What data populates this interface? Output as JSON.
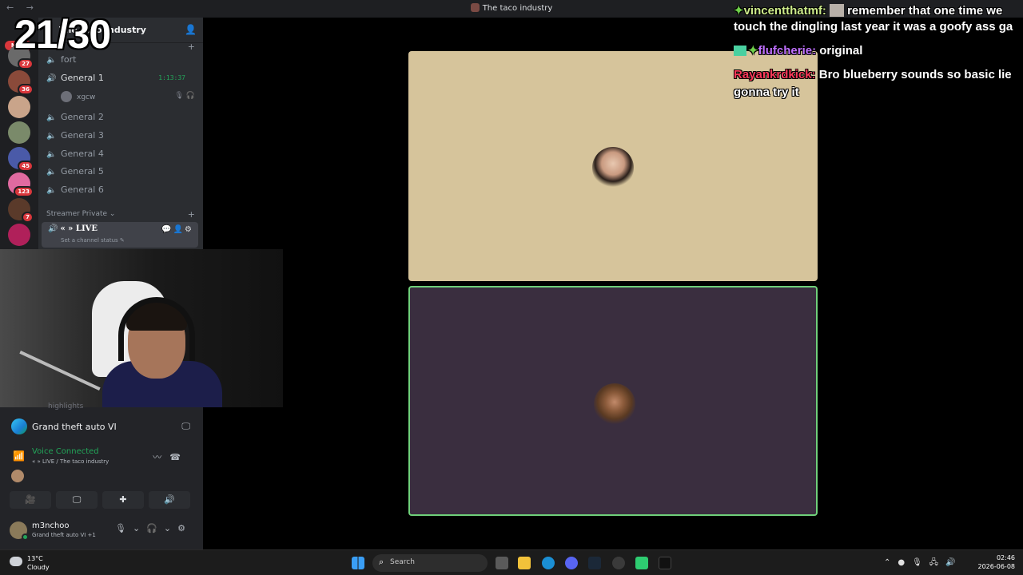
{
  "overlay": {
    "counter": "21/30"
  },
  "titlebar": {
    "title": "The taco industry",
    "nav": "← →"
  },
  "rail": {
    "new_label": "NEW",
    "servers": [
      {
        "badge": "27",
        "color": "#6a6a6a"
      },
      {
        "badge": "36",
        "color": "#8a4a3a"
      },
      {
        "badge": "",
        "color": "#c9a48a"
      },
      {
        "badge": "",
        "color": "#7a8a6a"
      },
      {
        "badge": "45",
        "color": "#4a5aa8"
      },
      {
        "badge": "123",
        "color": "#e06aa0"
      },
      {
        "badge": "7",
        "color": "#5a3a2a"
      },
      {
        "badge": "",
        "color": "#b0205a"
      }
    ]
  },
  "channels": {
    "server_name": "The taco industry",
    "items": [
      {
        "label": "fort"
      },
      {
        "label": "General 1",
        "timer": "1:13:37"
      },
      {
        "label": "General 2"
      },
      {
        "label": "General 3"
      },
      {
        "label": "General 4"
      },
      {
        "label": "General 5"
      },
      {
        "label": "General 6"
      }
    ],
    "member": "xgcw",
    "category": "Streamer Private",
    "live_channel": "« » LIVE",
    "live_status": "Set a channel status"
  },
  "lower": {
    "highlights": "highlights",
    "activity": "Grand theft auto VI",
    "voice_title": "Voice Connected",
    "voice_sub": "« » LIVE / The taco industry",
    "user_name": "m3nchoo",
    "user_status": "Grand theft auto VI +1"
  },
  "chat": [
    {
      "name": "vincentthatmf:",
      "text": "remember that one time we"
    },
    {
      "text": "touch the dingling last year it was a goofy ass ga"
    },
    {
      "name": "flufcherie:",
      "text": "original"
    },
    {
      "name": "Rayankrdkick:",
      "text": "Bro blueberry sounds so basic lie"
    },
    {
      "text": "gonna try it"
    }
  ],
  "taskbar": {
    "temp": "13°C",
    "condition": "Cloudy",
    "search_placeholder": "Search",
    "time": "02:46",
    "date": "2026-06-08"
  }
}
